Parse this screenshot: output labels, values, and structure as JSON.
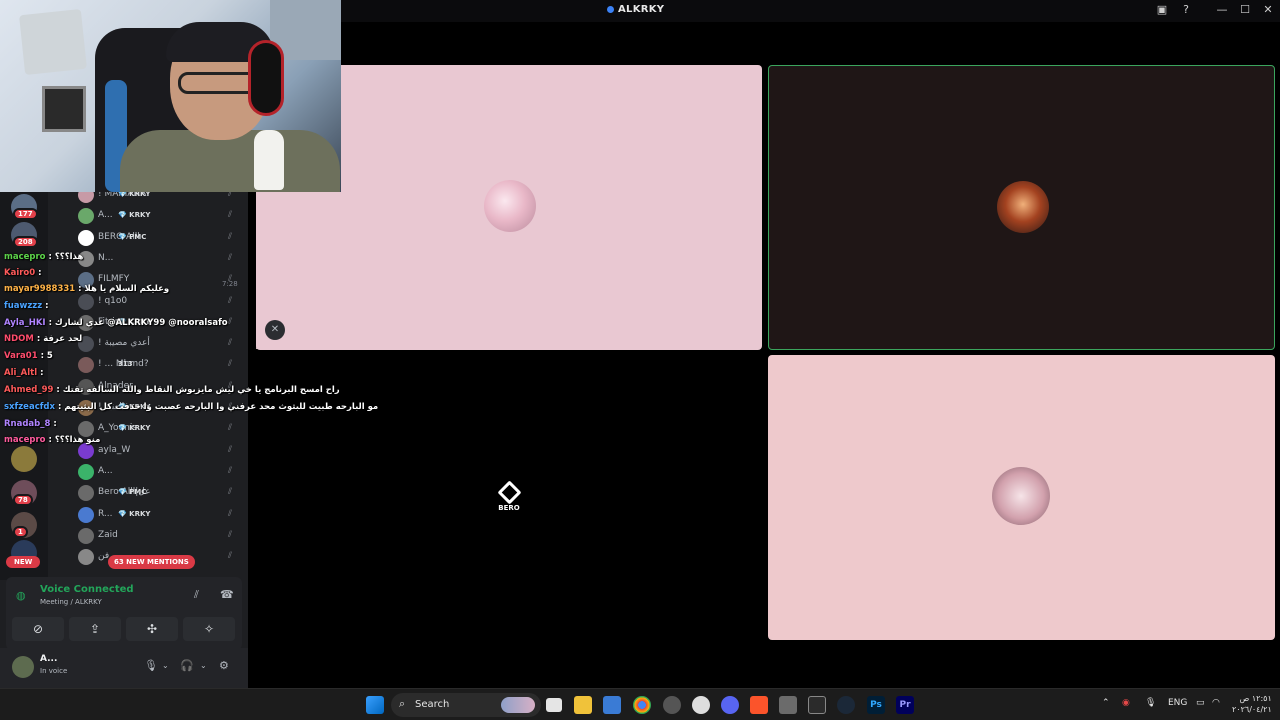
{
  "window": {
    "title": "ALKRKY"
  },
  "voice_list": [
    {
      "name": "! MARIANA",
      "tag": "💎 KRKY"
    },
    {
      "name": "A...",
      "tag": "💎 KRKY"
    },
    {
      "name": "BERO Alll",
      "tag": "💎 PMC"
    },
    {
      "name": "N...",
      "tag": ""
    },
    {
      "name": "FILMFY",
      "tag": ""
    },
    {
      "name": "! q1o0",
      "tag": ""
    },
    {
      "name": "Fitrim",
      "tag": "💎 KRKY"
    },
    {
      "name": "! أعدي مصيبة",
      "tag": ""
    },
    {
      "name": "! ... Mhmd?",
      "tag": "313"
    },
    {
      "name": "Alnader",
      "tag": ""
    },
    {
      "name": "! العنيد",
      "tag": "💎 KRKY"
    },
    {
      "name": "A_Younis",
      "tag": "💎 KRKY"
    },
    {
      "name": "ayla_W",
      "tag": ""
    },
    {
      "name": "A...",
      "tag": ""
    },
    {
      "name": "Bero Alll|عل",
      "tag": "💎 PMC"
    },
    {
      "name": "R...",
      "tag": "💎 KRKY"
    },
    {
      "name": "Zaid",
      "tag": ""
    },
    {
      "name": "فن",
      "tag": ""
    }
  ],
  "guild_badges": [
    "177",
    "208",
    "78",
    "1"
  ],
  "new_pill": "NEW",
  "mentions_pill": "63 NEW MENTIONS",
  "time_stamp": "7:28",
  "voice": {
    "status": "Voice Connected",
    "channel": "Meeting / ALKRKY"
  },
  "user": {
    "name": "A...",
    "status": "In voice"
  },
  "chat": [
    {
      "user": "macepro",
      "color": "#5dd44a",
      "msg": ": هذا؟؟؟"
    },
    {
      "user": "Kairo0",
      "color": "#ff5b5b",
      "msg": ":"
    },
    {
      "user": "mayar9988331",
      "color": "#ffb347",
      "msg": ": وعليكم السلام يا هلا"
    },
    {
      "user": "fuawzzz",
      "color": "#4aa3ff",
      "msg": ":"
    },
    {
      "user": "Ayla_HKI",
      "color": "#b084ff",
      "msg": ": عدي لشارك @ALKRKY99 @nooralsafo"
    },
    {
      "user": "NDOM",
      "color": "#ff4d6d",
      "msg": ": لحد عرفة"
    },
    {
      "user": "Vara01",
      "color": "#ff4d6d",
      "msg": ": 5"
    },
    {
      "user": "Ali_Altl",
      "color": "#ff5b5b",
      "msg": ":"
    },
    {
      "user": "Ahmed_99",
      "color": "#ff5b5b",
      "msg": ": راح امسح البرنامج يا خي ليش مايزبوش النقاط والله السالفه تقتك"
    },
    {
      "user": "sxfzeacfdx",
      "color": "#4aa3ff",
      "msg": ": مو البارحه طبيت للبثوث محد عرفني وا البارحه عصبت وا حذفت كل البثيتهم"
    },
    {
      "user": "Rnadab_8",
      "color": "#b084ff",
      "msg": ":"
    },
    {
      "user": "macepro",
      "color": "#ff5b9e",
      "msg": ": منو هذا؟؟؟"
    }
  ],
  "stage": {
    "logo_text": "BERO"
  },
  "taskbar": {
    "search_placeholder": "Search",
    "lang": "ENG",
    "time": "١٢:٥١ ص",
    "date": "٢٠٢٦/٠٤/٢١"
  },
  "colors": {
    "voice_green": "#23a55a",
    "speaking_border": "#3ba55d",
    "badge_red": "#da3a46"
  }
}
